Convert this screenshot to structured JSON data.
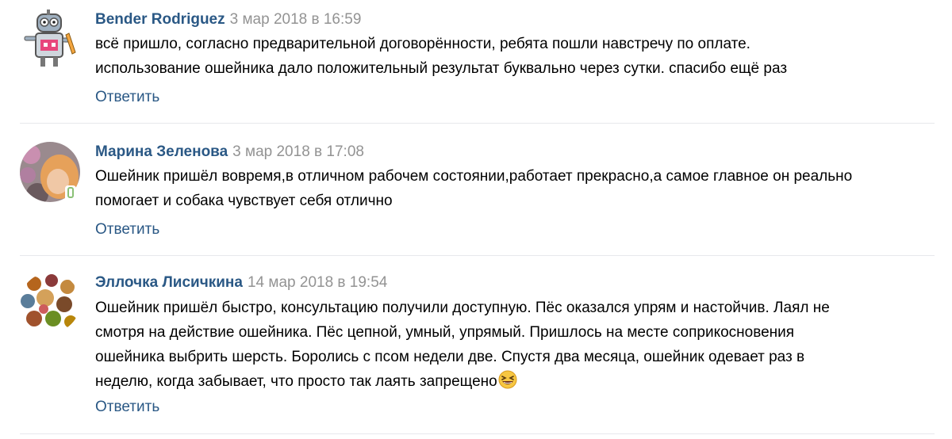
{
  "comments": [
    {
      "author": "Bender Rodriguez",
      "date": "3 мар 2018 в 16:59",
      "lines": [
        "всё пришло, согласно предварительной договорённости, ребята пошли навстречу по оплате.",
        "использование ошейника дало положительный результат буквально через сутки. спасибо ещё раз"
      ],
      "reply_label": "Ответить",
      "avatar_icon": "robot-avatar-icon"
    },
    {
      "author": "Марина Зеленова",
      "date": "3 мар 2018 в 17:08",
      "lines": [
        "Ошейник пришёл вовремя,в отличном рабочем состоянии,работает прекрасно,а самое главное он реально",
        "помогает и собака чувствует себя отлично"
      ],
      "reply_label": "Ответить",
      "avatar_icon": "user-photo-avatar",
      "online_icon": "mobile-online-icon"
    },
    {
      "author": "Эллочка Лисичкина",
      "date": "14 мар 2018 в 19:54",
      "lines": [
        "Ошейник пришёл быстро, консультацию получили доступную. Пёс оказался упрям и настойчив. Лаял не",
        "смотря на действие ошейника. Пёс цепной, умный, упрямый. Пришлось на месте соприкосновения",
        "ошейника выбрить шерсть. Боролись с псом недели две. Спустя два месяца, ошейник одевает раз в",
        "неделю, когда забывает, что просто так лаять запрещено"
      ],
      "reply_label": "Ответить",
      "avatar_icon": "collage-avatar",
      "trailing_icon": "laughing-emoji-icon"
    }
  ],
  "colors": {
    "author": "#2a5885",
    "date": "#939393",
    "reply": "#2a5885",
    "divider": "#e7e8ec",
    "online": "#8ac176"
  }
}
